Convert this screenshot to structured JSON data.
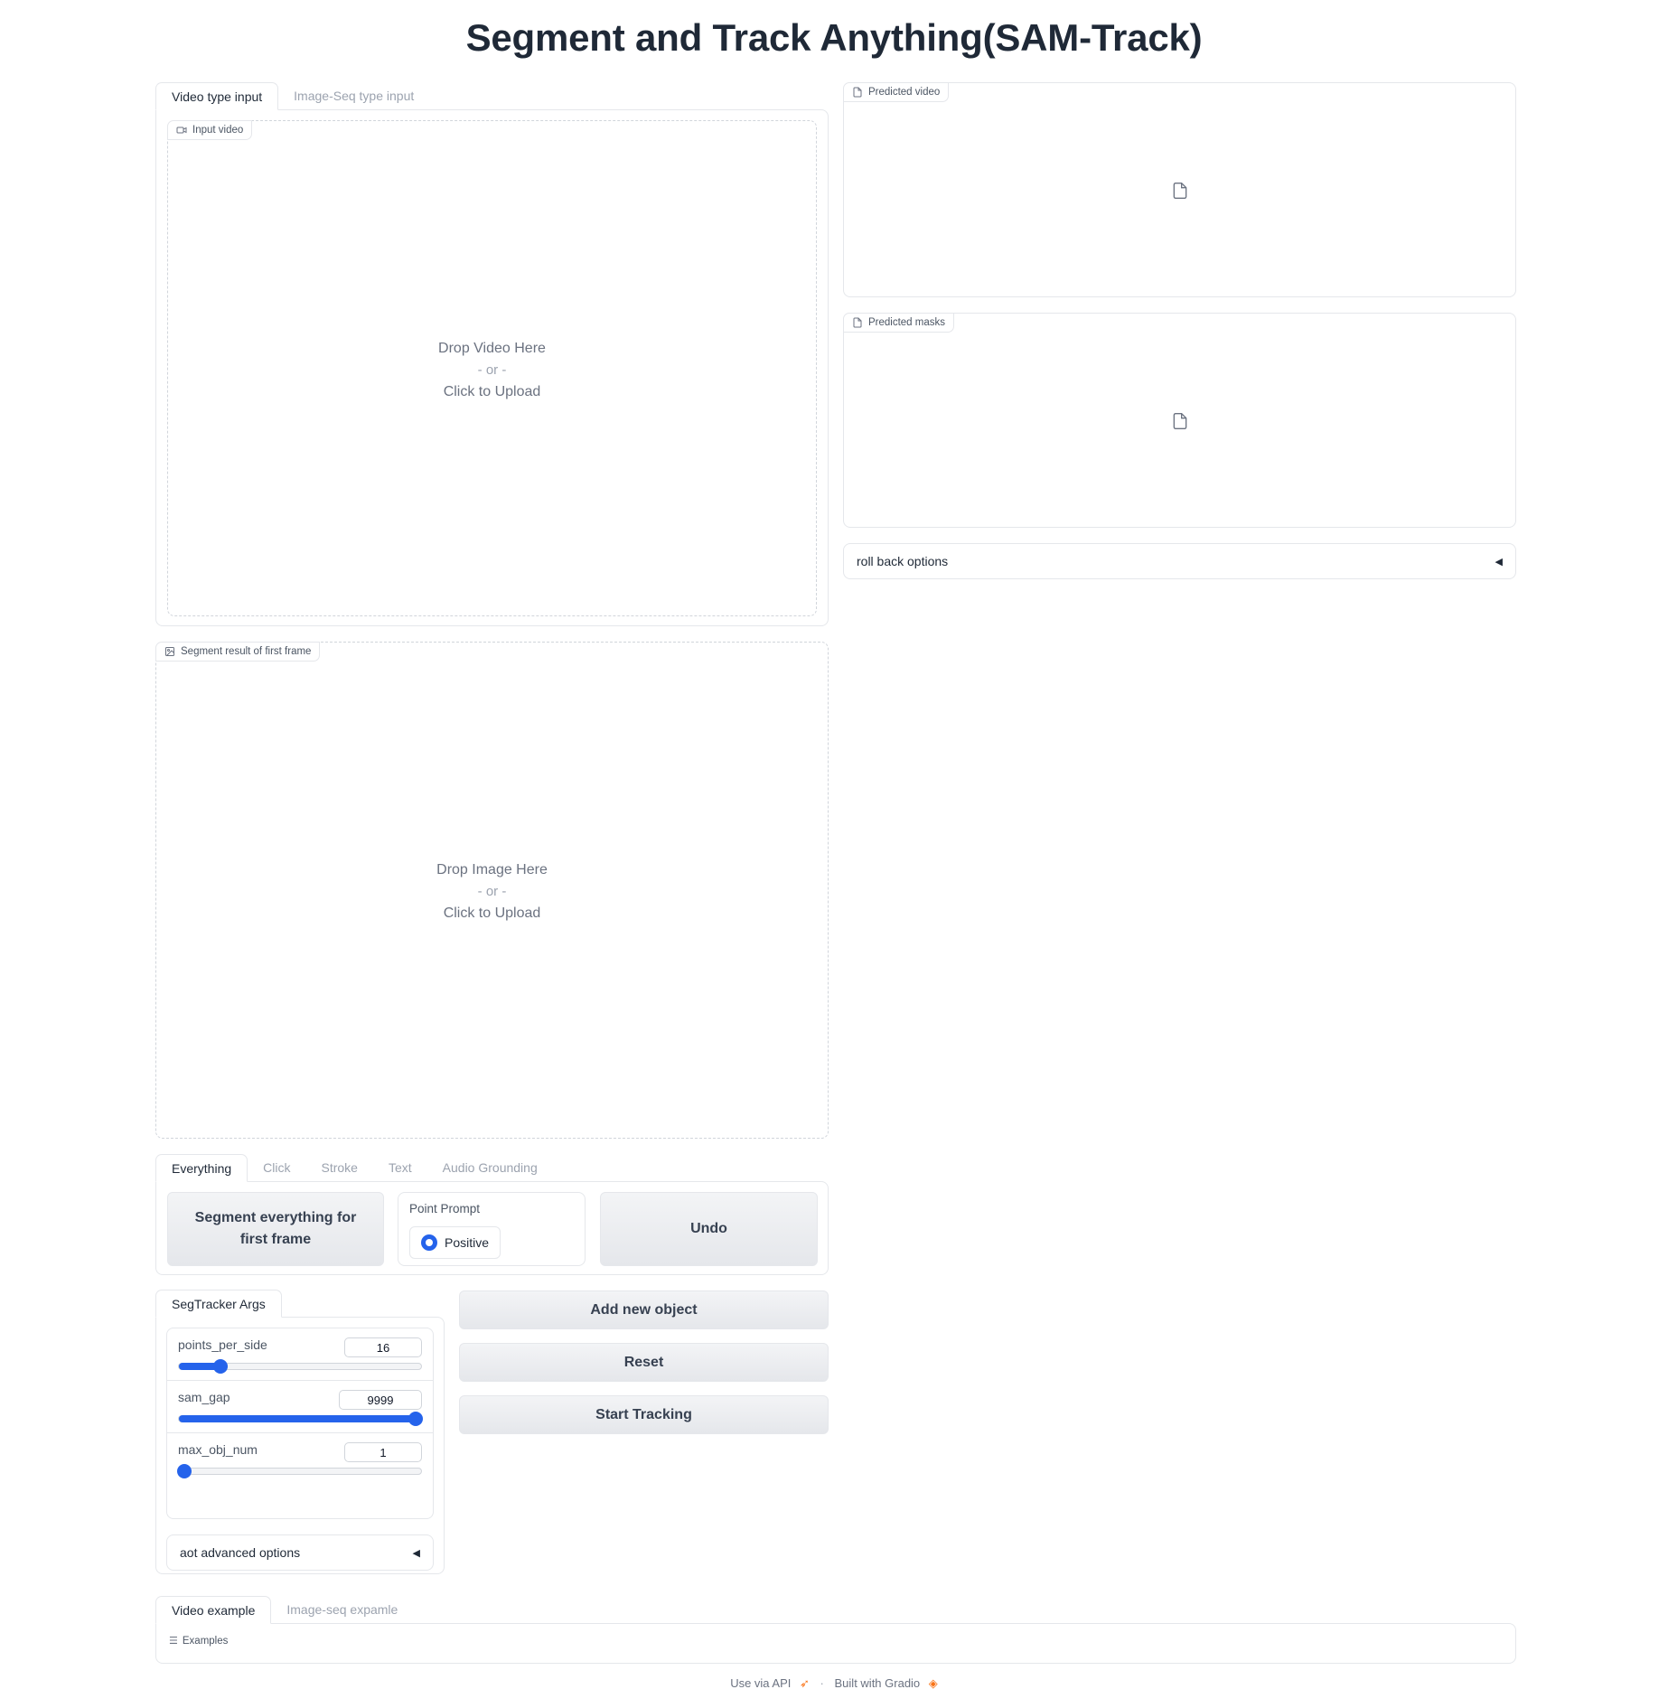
{
  "page": {
    "title": "Segment and Track Anything(SAM-Track)"
  },
  "input_tabs": [
    "Video type input",
    "Image-Seq type input"
  ],
  "input_video": {
    "label": "Input video",
    "drop_text": "Drop Video Here",
    "or_text": "- or -",
    "click_text": "Click to Upload"
  },
  "segment_result": {
    "label": "Segment result of first frame",
    "drop_text": "Drop Image Here",
    "or_text": "- or -",
    "click_text": "Click to Upload"
  },
  "predicted_video": {
    "label": "Predicted video"
  },
  "predicted_masks": {
    "label": "Predicted masks"
  },
  "rollback": {
    "label": "roll back options",
    "arrow": "◀"
  },
  "mode_tabs": [
    "Everything",
    "Click",
    "Stroke",
    "Text",
    "Audio Grounding"
  ],
  "everything": {
    "segment_button": "Segment everything for first frame",
    "point_prompt_label": "Point Prompt",
    "positive_label": "Positive",
    "undo_button": "Undo"
  },
  "segtracker": {
    "tab_label": "SegTracker Args",
    "points_per_side": {
      "label": "points_per_side",
      "value": "16",
      "fraction": 0.17
    },
    "sam_gap": {
      "label": "sam_gap",
      "value": "9999",
      "fraction": 1.0
    },
    "max_obj_num": {
      "label": "max_obj_num",
      "value": "1",
      "fraction": 0.0
    },
    "aot_label": "aot advanced options",
    "arrow": "◀"
  },
  "actions": {
    "add_new_object": "Add new object",
    "reset": "Reset",
    "start_tracking": "Start Tracking"
  },
  "example_tabs": [
    "Video example",
    "Image-seq expamle"
  ],
  "examples_label": "Examples",
  "footer": {
    "api": "Use via API",
    "sep": "·",
    "built": "Built with Gradio"
  },
  "colors": {
    "accent": "#2563eb",
    "border": "#e5e7eb",
    "text": "#1f2937",
    "muted": "#9ca3af"
  }
}
